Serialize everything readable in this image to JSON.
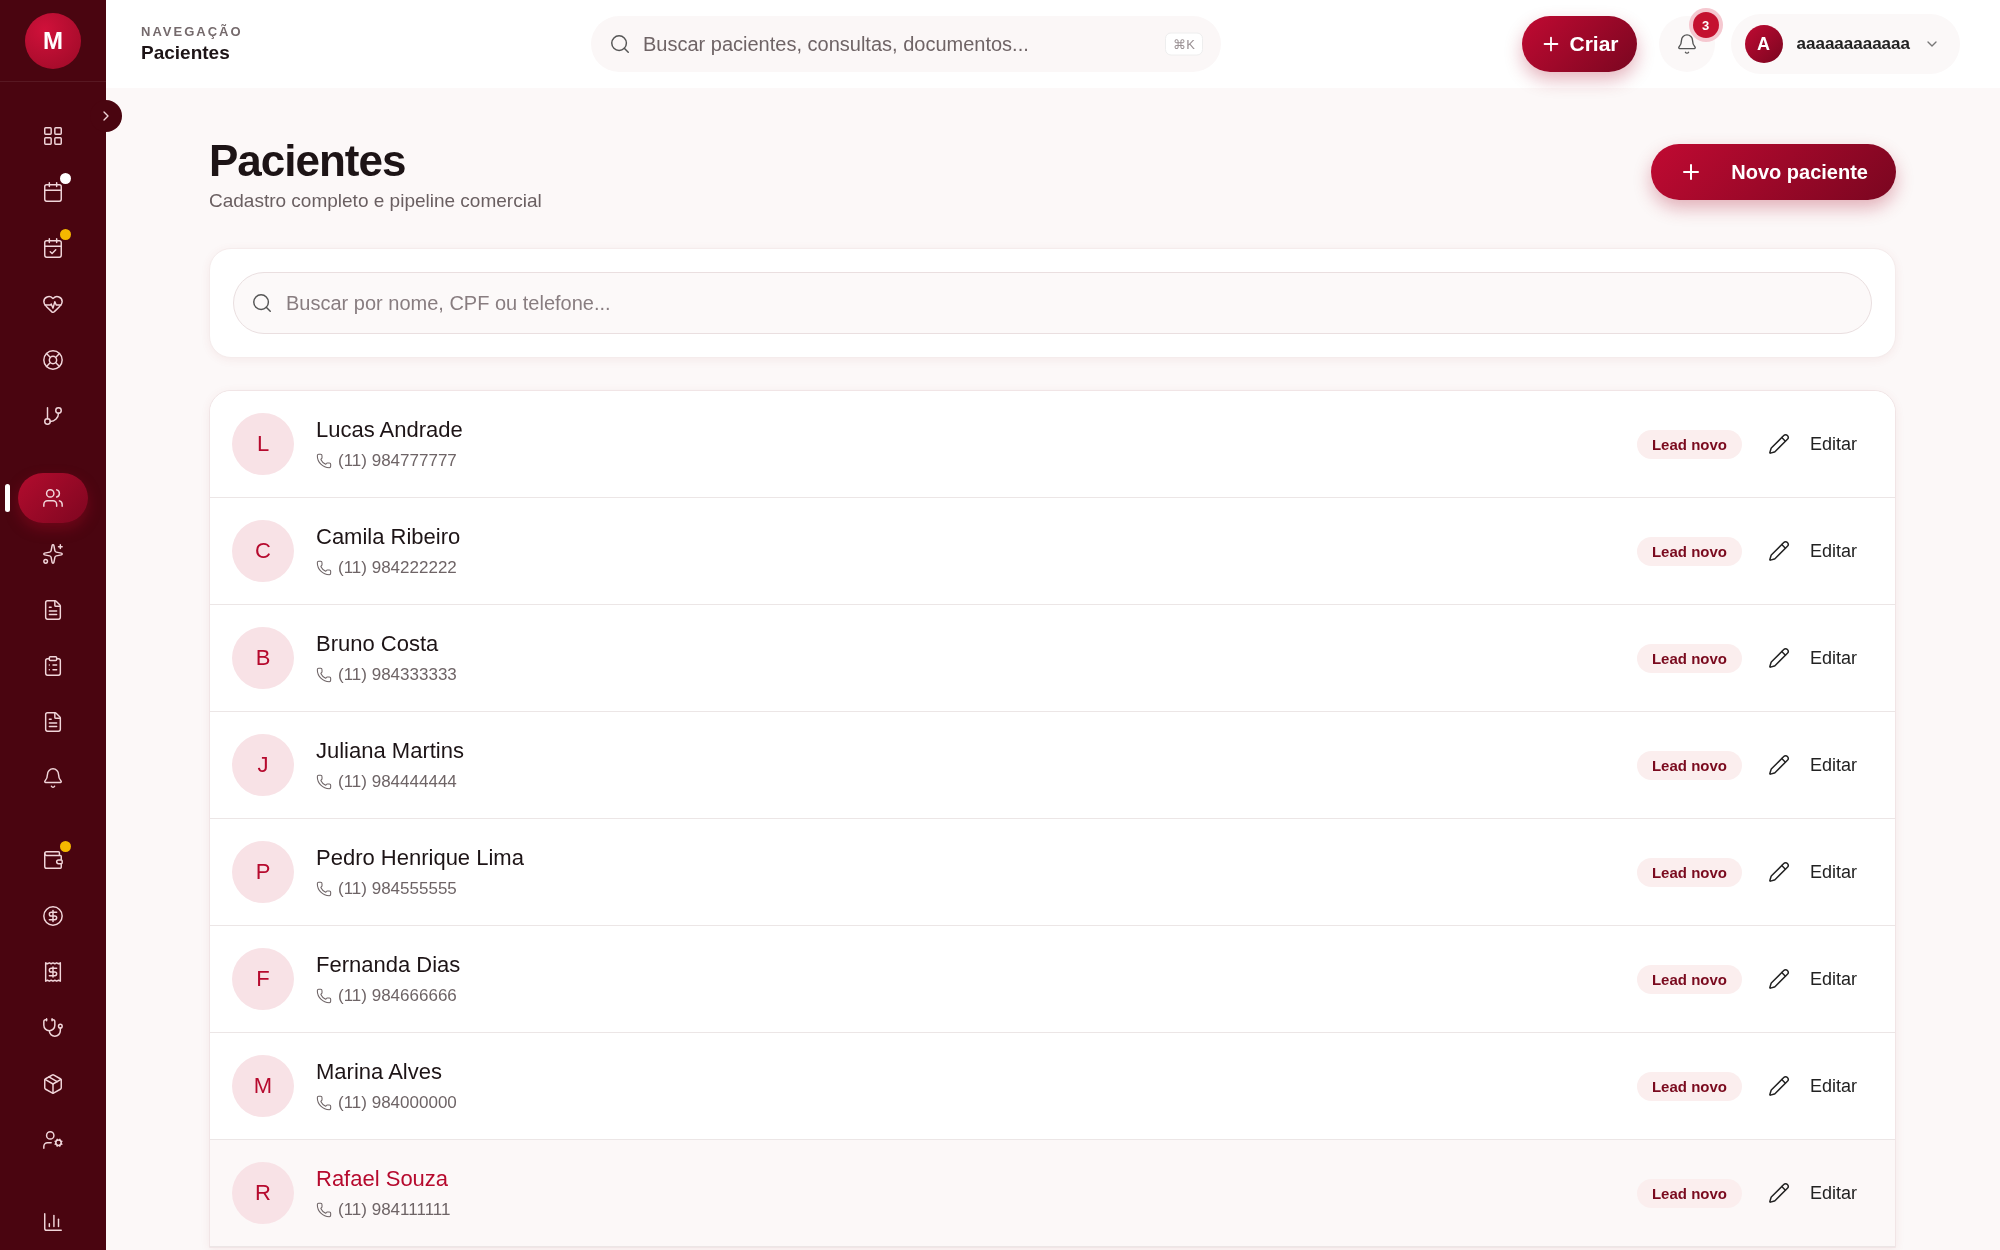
{
  "brand": {
    "initial": "M"
  },
  "sidebar": {
    "groups": [
      {
        "items": [
          {
            "selected": false
          },
          {
            "selected": false,
            "color": "#ffffff"
          },
          {
            "selected": false,
            "color": "#f5b800"
          },
          {
            "selected": false
          },
          {
            "selected": false
          },
          {
            "selected": false
          }
        ]
      },
      {
        "items": [
          {
            "selected": true
          },
          {
            "selected": false
          },
          {
            "selected": false
          },
          {
            "selected": false
          },
          {
            "selected": false
          },
          {
            "selected": false
          }
        ]
      },
      {
        "items": [
          {
            "selected": false,
            "color": "#f5b800"
          },
          {
            "selected": false
          },
          {
            "selected": false
          },
          {
            "selected": false
          },
          {
            "selected": false
          },
          {
            "selected": false
          }
        ]
      },
      {
        "items": [
          {
            "selected": false
          }
        ]
      }
    ]
  },
  "header": {
    "eyebrow": "NAVEGAÇÃO",
    "title": "Pacientes",
    "search": {
      "placeholder": "Buscar pacientes, consultas, documentos...",
      "shortcut": "⌘K"
    },
    "create_button": "Criar",
    "notifications": {
      "count": "3"
    },
    "user": {
      "initial": "A",
      "name": "aaaaaaaaaaaa"
    }
  },
  "page": {
    "title": "Pacientes",
    "subtitle": "Cadastro completo e pipeline comercial",
    "new_button": "Novo paciente",
    "search": {
      "placeholder": "Buscar por nome, CPF ou telefone..."
    }
  },
  "patients": [
    {
      "initial": "L",
      "name": "Lucas Andrade",
      "phone": "(11) 984777777",
      "status": "Lead novo",
      "action": "Editar",
      "highlighted": false
    },
    {
      "initial": "C",
      "name": "Camila Ribeiro",
      "phone": "(11) 984222222",
      "status": "Lead novo",
      "action": "Editar",
      "highlighted": false
    },
    {
      "initial": "B",
      "name": "Bruno Costa",
      "phone": "(11) 984333333",
      "status": "Lead novo",
      "action": "Editar",
      "highlighted": false
    },
    {
      "initial": "J",
      "name": "Juliana Martins",
      "phone": "(11) 984444444",
      "status": "Lead novo",
      "action": "Editar",
      "highlighted": false
    },
    {
      "initial": "P",
      "name": "Pedro Henrique Lima",
      "phone": "(11) 984555555",
      "status": "Lead novo",
      "action": "Editar",
      "highlighted": false
    },
    {
      "initial": "F",
      "name": "Fernanda Dias",
      "phone": "(11) 984666666",
      "status": "Lead novo",
      "action": "Editar",
      "highlighted": false
    },
    {
      "initial": "M",
      "name": "Marina Alves",
      "phone": "(11) 984000000",
      "status": "Lead novo",
      "action": "Editar",
      "highlighted": false
    },
    {
      "initial": "R",
      "name": "Rafael Souza",
      "phone": "(11) 984111111",
      "status": "Lead novo",
      "action": "Editar",
      "highlighted": true
    }
  ]
}
